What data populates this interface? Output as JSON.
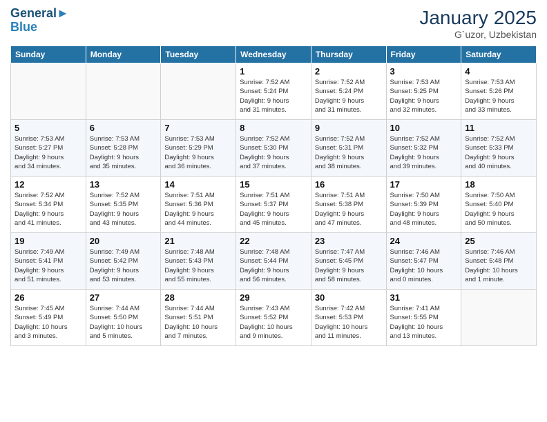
{
  "header": {
    "logo_line1": "General",
    "logo_line2": "Blue",
    "month_year": "January 2025",
    "location": "G`uzor, Uzbekistan"
  },
  "weekdays": [
    "Sunday",
    "Monday",
    "Tuesday",
    "Wednesday",
    "Thursday",
    "Friday",
    "Saturday"
  ],
  "weeks": [
    [
      {
        "day": "",
        "info": ""
      },
      {
        "day": "",
        "info": ""
      },
      {
        "day": "",
        "info": ""
      },
      {
        "day": "1",
        "info": "Sunrise: 7:52 AM\nSunset: 5:24 PM\nDaylight: 9 hours\nand 31 minutes."
      },
      {
        "day": "2",
        "info": "Sunrise: 7:52 AM\nSunset: 5:24 PM\nDaylight: 9 hours\nand 31 minutes."
      },
      {
        "day": "3",
        "info": "Sunrise: 7:53 AM\nSunset: 5:25 PM\nDaylight: 9 hours\nand 32 minutes."
      },
      {
        "day": "4",
        "info": "Sunrise: 7:53 AM\nSunset: 5:26 PM\nDaylight: 9 hours\nand 33 minutes."
      }
    ],
    [
      {
        "day": "5",
        "info": "Sunrise: 7:53 AM\nSunset: 5:27 PM\nDaylight: 9 hours\nand 34 minutes."
      },
      {
        "day": "6",
        "info": "Sunrise: 7:53 AM\nSunset: 5:28 PM\nDaylight: 9 hours\nand 35 minutes."
      },
      {
        "day": "7",
        "info": "Sunrise: 7:53 AM\nSunset: 5:29 PM\nDaylight: 9 hours\nand 36 minutes."
      },
      {
        "day": "8",
        "info": "Sunrise: 7:52 AM\nSunset: 5:30 PM\nDaylight: 9 hours\nand 37 minutes."
      },
      {
        "day": "9",
        "info": "Sunrise: 7:52 AM\nSunset: 5:31 PM\nDaylight: 9 hours\nand 38 minutes."
      },
      {
        "day": "10",
        "info": "Sunrise: 7:52 AM\nSunset: 5:32 PM\nDaylight: 9 hours\nand 39 minutes."
      },
      {
        "day": "11",
        "info": "Sunrise: 7:52 AM\nSunset: 5:33 PM\nDaylight: 9 hours\nand 40 minutes."
      }
    ],
    [
      {
        "day": "12",
        "info": "Sunrise: 7:52 AM\nSunset: 5:34 PM\nDaylight: 9 hours\nand 41 minutes."
      },
      {
        "day": "13",
        "info": "Sunrise: 7:52 AM\nSunset: 5:35 PM\nDaylight: 9 hours\nand 43 minutes."
      },
      {
        "day": "14",
        "info": "Sunrise: 7:51 AM\nSunset: 5:36 PM\nDaylight: 9 hours\nand 44 minutes."
      },
      {
        "day": "15",
        "info": "Sunrise: 7:51 AM\nSunset: 5:37 PM\nDaylight: 9 hours\nand 45 minutes."
      },
      {
        "day": "16",
        "info": "Sunrise: 7:51 AM\nSunset: 5:38 PM\nDaylight: 9 hours\nand 47 minutes."
      },
      {
        "day": "17",
        "info": "Sunrise: 7:50 AM\nSunset: 5:39 PM\nDaylight: 9 hours\nand 48 minutes."
      },
      {
        "day": "18",
        "info": "Sunrise: 7:50 AM\nSunset: 5:40 PM\nDaylight: 9 hours\nand 50 minutes."
      }
    ],
    [
      {
        "day": "19",
        "info": "Sunrise: 7:49 AM\nSunset: 5:41 PM\nDaylight: 9 hours\nand 51 minutes."
      },
      {
        "day": "20",
        "info": "Sunrise: 7:49 AM\nSunset: 5:42 PM\nDaylight: 9 hours\nand 53 minutes."
      },
      {
        "day": "21",
        "info": "Sunrise: 7:48 AM\nSunset: 5:43 PM\nDaylight: 9 hours\nand 55 minutes."
      },
      {
        "day": "22",
        "info": "Sunrise: 7:48 AM\nSunset: 5:44 PM\nDaylight: 9 hours\nand 56 minutes."
      },
      {
        "day": "23",
        "info": "Sunrise: 7:47 AM\nSunset: 5:45 PM\nDaylight: 9 hours\nand 58 minutes."
      },
      {
        "day": "24",
        "info": "Sunrise: 7:46 AM\nSunset: 5:47 PM\nDaylight: 10 hours\nand 0 minutes."
      },
      {
        "day": "25",
        "info": "Sunrise: 7:46 AM\nSunset: 5:48 PM\nDaylight: 10 hours\nand 1 minute."
      }
    ],
    [
      {
        "day": "26",
        "info": "Sunrise: 7:45 AM\nSunset: 5:49 PM\nDaylight: 10 hours\nand 3 minutes."
      },
      {
        "day": "27",
        "info": "Sunrise: 7:44 AM\nSunset: 5:50 PM\nDaylight: 10 hours\nand 5 minutes."
      },
      {
        "day": "28",
        "info": "Sunrise: 7:44 AM\nSunset: 5:51 PM\nDaylight: 10 hours\nand 7 minutes."
      },
      {
        "day": "29",
        "info": "Sunrise: 7:43 AM\nSunset: 5:52 PM\nDaylight: 10 hours\nand 9 minutes."
      },
      {
        "day": "30",
        "info": "Sunrise: 7:42 AM\nSunset: 5:53 PM\nDaylight: 10 hours\nand 11 minutes."
      },
      {
        "day": "31",
        "info": "Sunrise: 7:41 AM\nSunset: 5:55 PM\nDaylight: 10 hours\nand 13 minutes."
      },
      {
        "day": "",
        "info": ""
      }
    ]
  ]
}
